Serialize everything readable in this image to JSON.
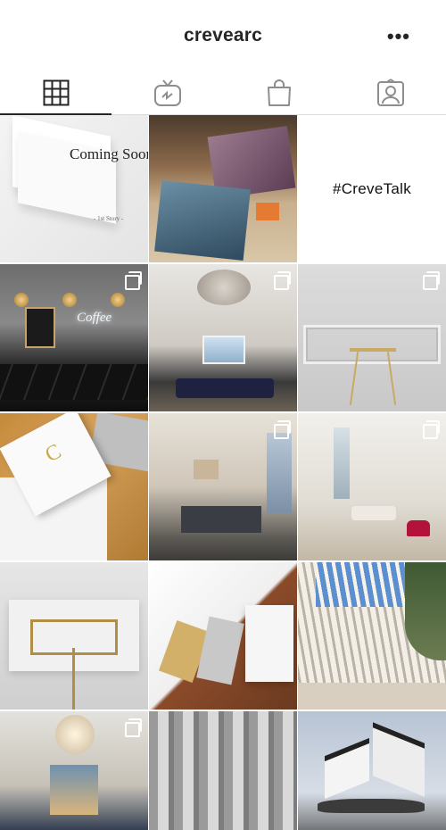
{
  "header": {
    "username": "crevearc",
    "more_label": "•••"
  },
  "tabs": [
    {
      "id": "grid",
      "icon": "grid-icon",
      "active": true
    },
    {
      "id": "igtv",
      "icon": "igtv-icon",
      "active": false
    },
    {
      "id": "shop",
      "icon": "shopping-bag-icon",
      "active": false
    },
    {
      "id": "tagged",
      "icon": "tagged-icon",
      "active": false
    }
  ],
  "posts": [
    {
      "caption": "Coming Soon",
      "subcaption": "- 1st Story -",
      "multi": false
    },
    {
      "caption": "",
      "multi": false
    },
    {
      "caption": "#CreveTalk",
      "multi": false
    },
    {
      "caption": "Coffee",
      "multi": true
    },
    {
      "caption": "",
      "multi": true
    },
    {
      "caption": "",
      "multi": true
    },
    {
      "caption": "C",
      "multi": false
    },
    {
      "caption": "",
      "multi": true
    },
    {
      "caption": "",
      "multi": true
    },
    {
      "caption": "",
      "multi": false
    },
    {
      "caption": "",
      "multi": false
    },
    {
      "caption": "",
      "multi": false
    },
    {
      "caption": "",
      "multi": true
    },
    {
      "caption": "",
      "multi": false
    },
    {
      "caption": "",
      "multi": false
    }
  ]
}
